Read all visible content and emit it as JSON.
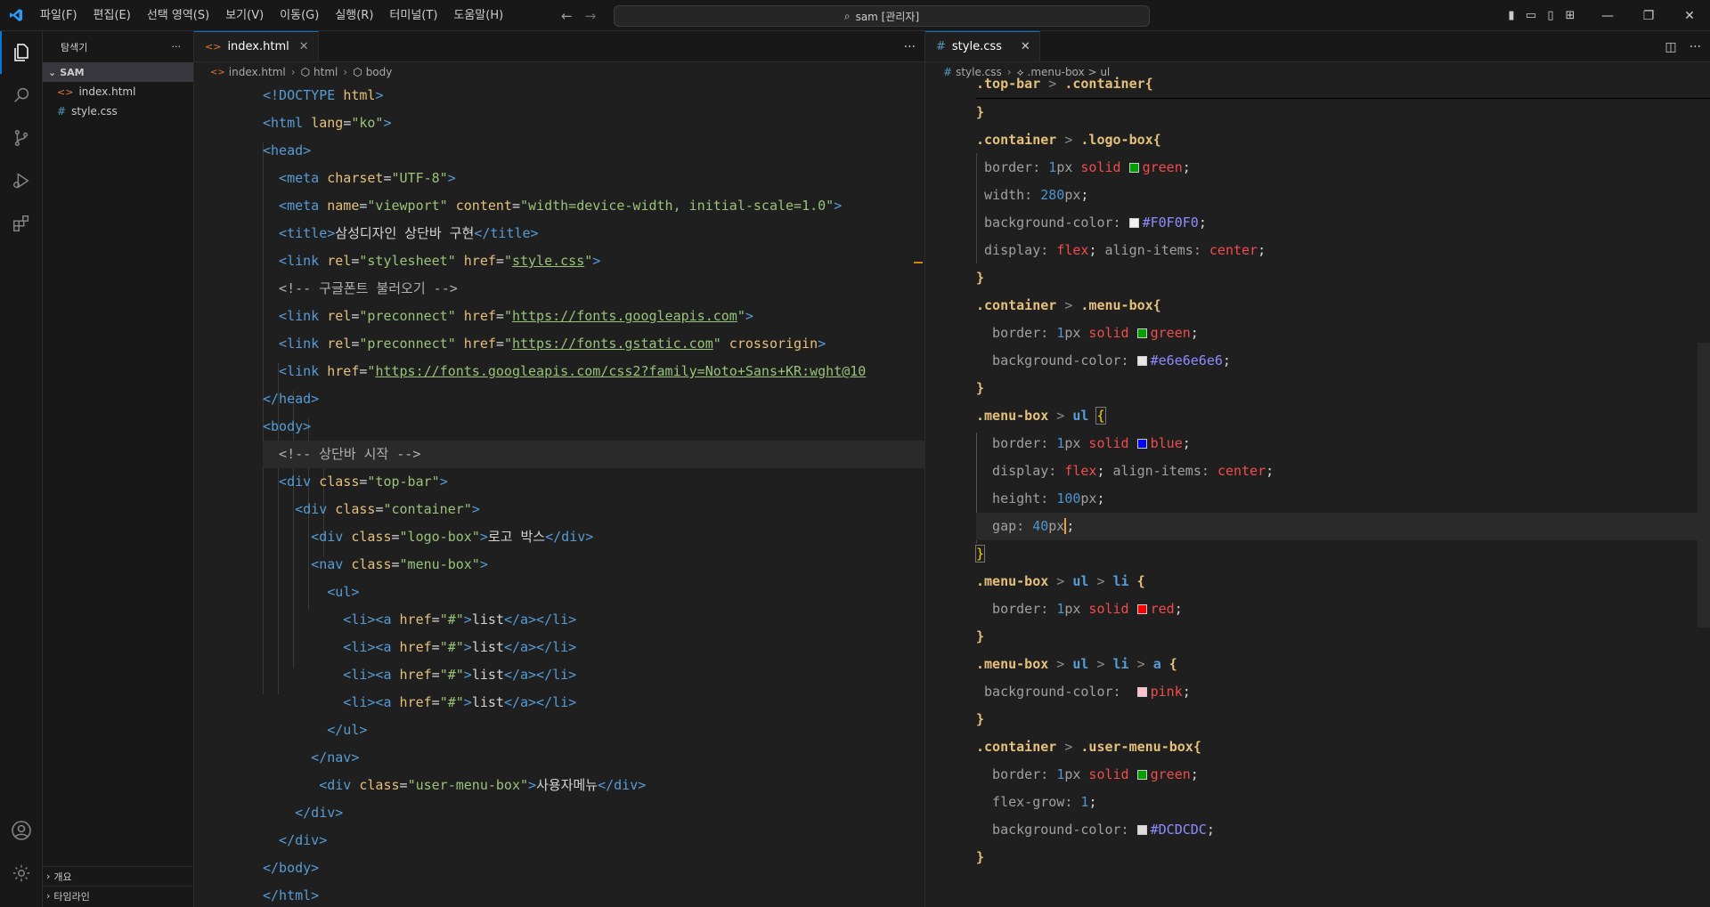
{
  "menu": [
    "파일(F)",
    "편집(E)",
    "선택 영역(S)",
    "보기(V)",
    "이동(G)",
    "실행(R)",
    "터미널(T)",
    "도움말(H)"
  ],
  "search": {
    "text": "sam [관리자]"
  },
  "sidebar": {
    "title": "탐색기",
    "folder": "SAM",
    "files": [
      "index.html",
      "style.css"
    ],
    "outline": "개요",
    "timeline": "타임라인"
  },
  "left_editor": {
    "tab": "index.html",
    "breadcrumb": [
      "index.html",
      "html",
      "body"
    ],
    "lines": [
      "<!DOCTYPE html>",
      "<html lang=\"ko\">",
      "<head>",
      "  <meta charset=\"UTF-8\">",
      "  <meta name=\"viewport\" content=\"width=device-width, initial-scale=1.0\">",
      "  <title>삼성디자인 상단바 구현</title>",
      "  <link rel=\"stylesheet\" href=\"style.css\">",
      "  <!-- 구글폰트 불러오기 -->",
      "  <link rel=\"preconnect\" href=\"https://fonts.googleapis.com\">",
      "  <link rel=\"preconnect\" href=\"https://fonts.gstatic.com\" crossorigin>",
      "  <link href=\"https://fonts.googleapis.com/css2?family=Noto+Sans+KR:wght@10",
      "</head>",
      "<body>",
      "  <!-- 상단바 시작 -->",
      "  <div class=\"top-bar\">",
      "    <div class=\"container\">",
      "      <div class=\"logo-box\">로고 박스</div>",
      "      <nav class=\"menu-box\">",
      "        <ul>",
      "          <li><a href=\"#\">list</a></li>",
      "          <li><a href=\"#\">list</a></li>",
      "          <li><a href=\"#\">list</a></li>",
      "          <li><a href=\"#\">list</a></li>",
      "        </ul>",
      "      </nav>",
      "      <div class=\"user-menu-box\">사용자메뉴</div>",
      "    </div>",
      "  </div>",
      "</body>",
      "</html>"
    ]
  },
  "right_editor": {
    "tab": "style.css",
    "breadcrumb": [
      "style.css",
      ".menu-box > ul"
    ],
    "lines": [
      ".top-bar > .container{",
      "}",
      ".container > .logo-box{",
      "  border: 1px solid green;",
      "  width: 280px;",
      "  background-color: #F0F0F0;",
      "  display: flex; align-items: center;",
      "}",
      ".container > .menu-box{",
      "  border: 1px solid green;",
      "  background-color: #e6e6e6e6;",
      "}",
      ".menu-box > ul {",
      "  border: 1px solid blue;",
      "  display: flex; align-items: center;",
      "  height: 100px;",
      "  gap: 40px;",
      "}",
      ".menu-box > ul > li {",
      "  border: 1px solid red;",
      "}",
      ".menu-box > ul > li > a {",
      "  background-color:  pink;",
      "}",
      ".container > .user-menu-box{",
      "  border: 1px solid green;",
      "  flex-grow: 1;",
      "  background-color: #DCDCDC;",
      "}"
    ]
  },
  "colors": {
    "green": "#00a000",
    "blue": "#0000ff",
    "red": "#ff0000",
    "pink": "#ffc0cb",
    "f0": "#F0F0F0",
    "e6": "#e6e6e6",
    "dc": "#DCDCDC",
    "accent": "#0078d4"
  }
}
